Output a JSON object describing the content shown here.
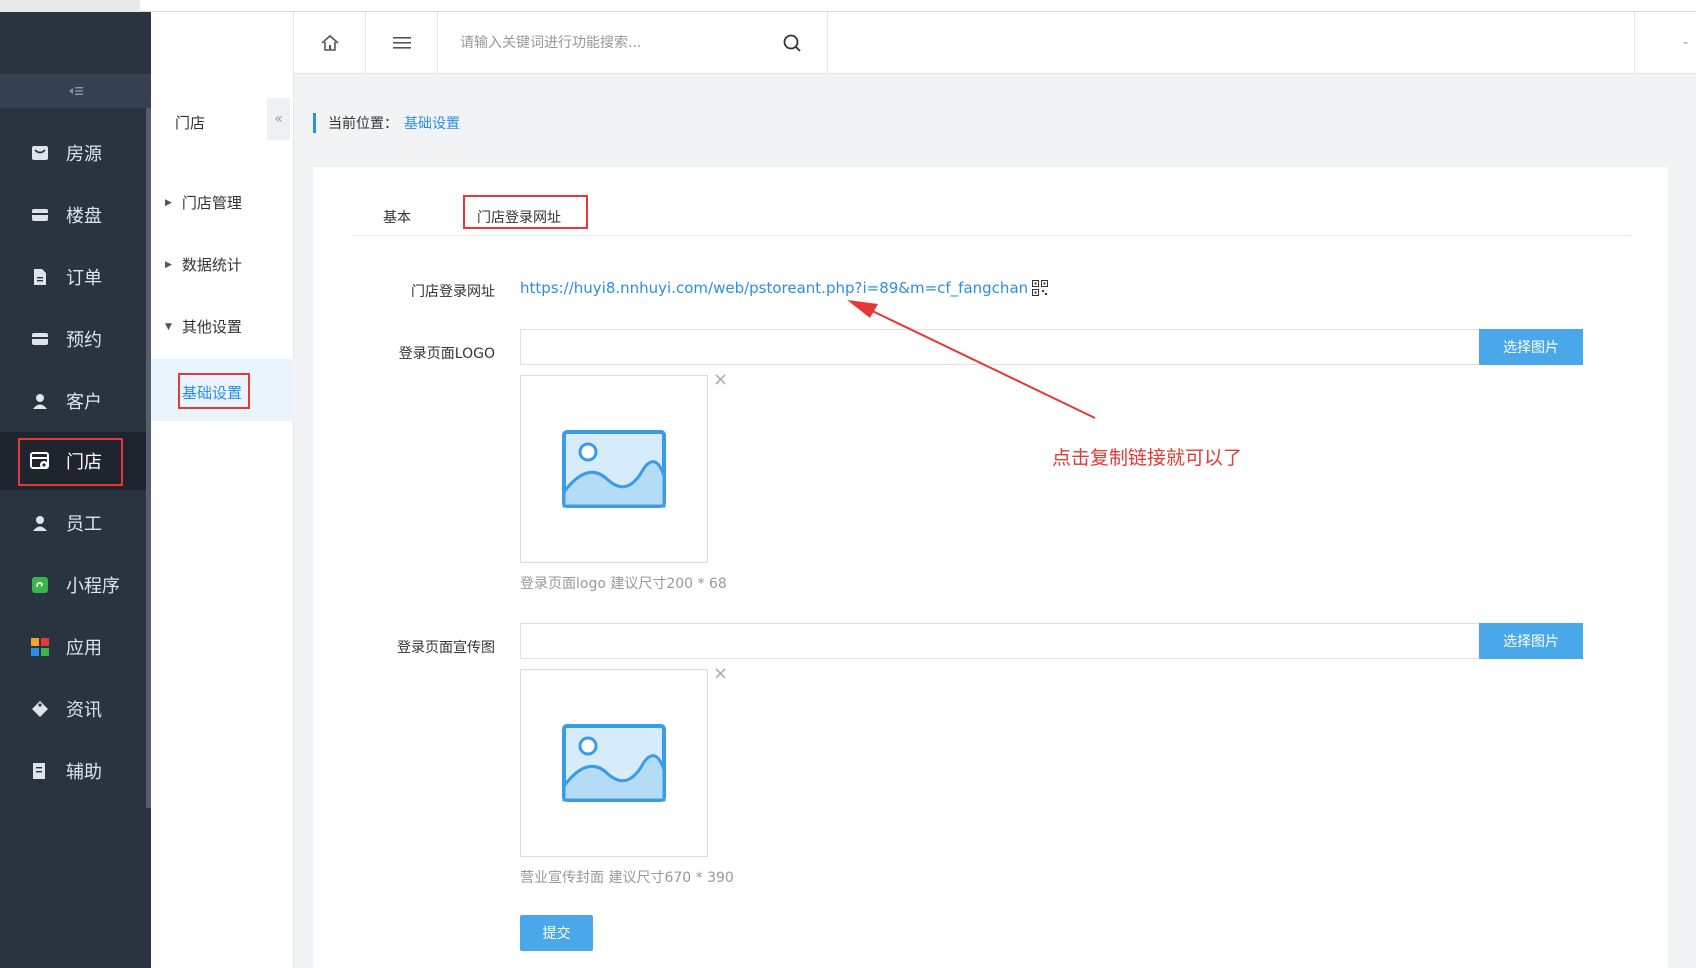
{
  "sidebar": {
    "items": [
      {
        "label": "房源",
        "icon": "house-listing-icon"
      },
      {
        "label": "楼盘",
        "icon": "building-icon"
      },
      {
        "label": "订单",
        "icon": "order-doc-icon"
      },
      {
        "label": "预约",
        "icon": "appointment-icon"
      },
      {
        "label": "客户",
        "icon": "customer-icon"
      },
      {
        "label": "门店",
        "icon": "store-icon",
        "active": true
      },
      {
        "label": "员工",
        "icon": "employee-icon"
      },
      {
        "label": "小程序",
        "icon": "mini-program-icon"
      },
      {
        "label": "应用",
        "icon": "apps-grid-icon"
      },
      {
        "label": "资讯",
        "icon": "news-tag-icon"
      },
      {
        "label": "辅助",
        "icon": "assist-doc-icon"
      }
    ]
  },
  "subnav": {
    "title": "门店",
    "groups": [
      "门店管理",
      "数据统计",
      "其他设置"
    ],
    "active_leaf": "基础设置"
  },
  "header": {
    "search_placeholder": "请输入关键词进行功能搜索..."
  },
  "breadcrumb": {
    "label": "当前位置：",
    "current": "基础设置"
  },
  "tabs": {
    "basic": "基本",
    "login_url": "门店登录网址"
  },
  "form": {
    "login_url_label": "门店登录网址",
    "login_url": "https://huyi8.nnhuyi.com/web/pstoreant.php?i=89&m=cf_fangchan",
    "logo_label": "登录页面LOGO",
    "logo_hint": "登录页面logo 建议尺寸200 * 68",
    "banner_label": "登录页面宣传图",
    "banner_hint": "营业宣传封面 建议尺寸670 * 390",
    "select_image": "选择图片",
    "remove": "×",
    "submit": "提交"
  },
  "annotation": "点击复制链接就可以了",
  "colors": {
    "sidebar_bg": "#2a3441",
    "accent_blue": "#2b8ee8",
    "button_blue": "#4aa8ea",
    "highlight_red": "#e53935"
  }
}
